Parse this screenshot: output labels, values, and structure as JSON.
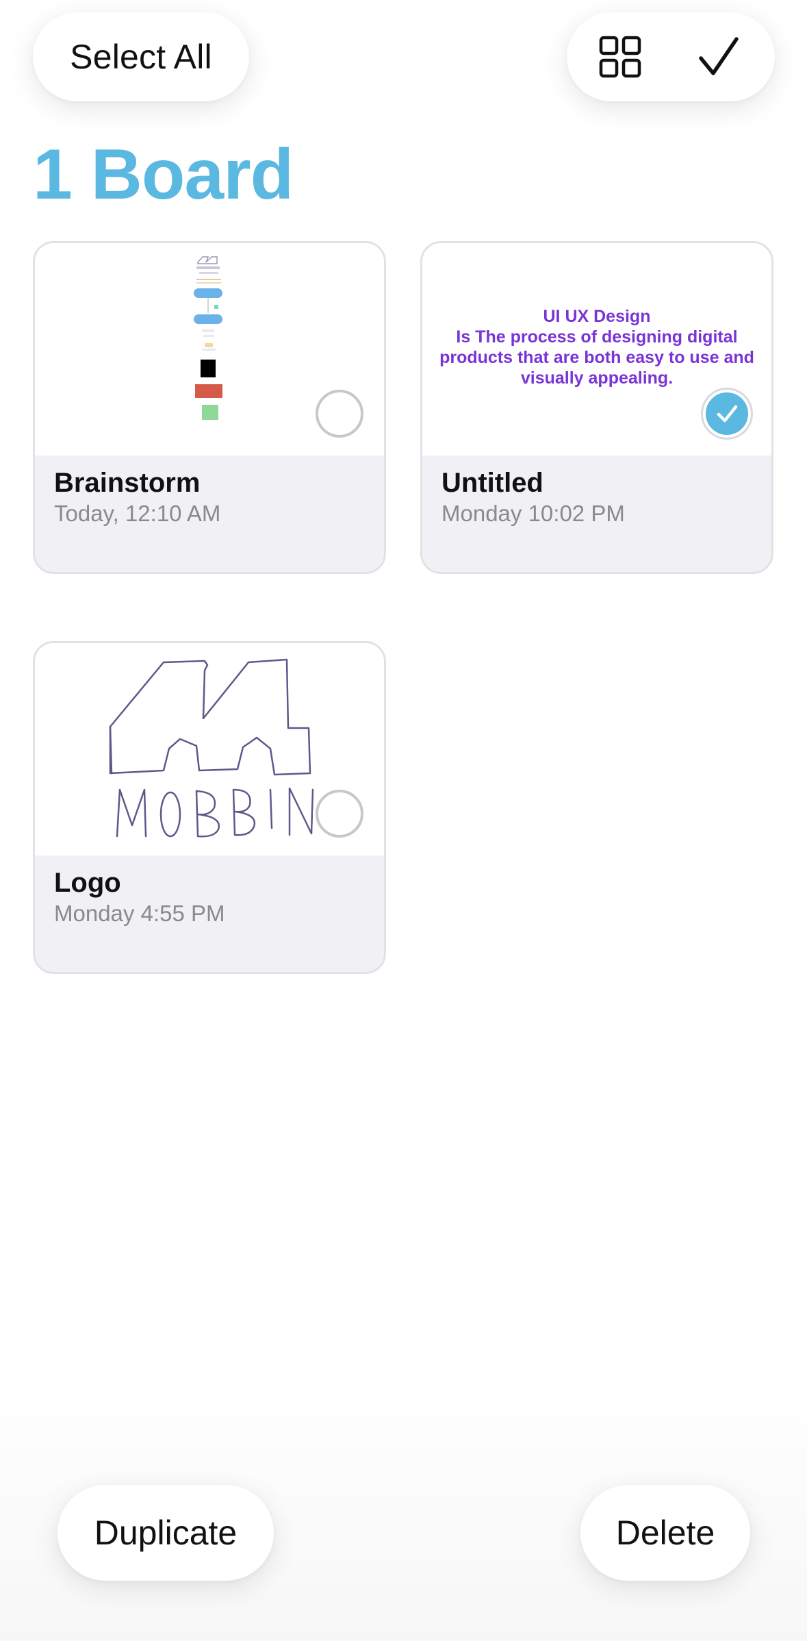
{
  "toolbar": {
    "select_all_label": "Select All",
    "grid_icon": "grid-icon",
    "done_icon": "checkmark-icon"
  },
  "heading": "1 Board",
  "boards": [
    {
      "title": "Brainstorm",
      "date": "Today, 12:10 AM",
      "selected": false,
      "thumbnail": "brainstorm-flowchart"
    },
    {
      "title": "Untitled",
      "date": "Monday 10:02 PM",
      "selected": true,
      "thumbnail": "text",
      "thumb_lines": [
        "UI UX Design",
        "Is The process of designing digital",
        "products that are both easy to use and",
        "visually appealing."
      ]
    },
    {
      "title": "Logo",
      "date": "Monday 4:55 PM",
      "selected": false,
      "thumbnail": "mobbin-sketch",
      "sketch_text": "MOBBIN"
    }
  ],
  "actions": {
    "duplicate_label": "Duplicate",
    "delete_label": "Delete"
  },
  "colors": {
    "accent": "#5bb8e0",
    "thumb_text": "#7a34d6",
    "sketch_ink": "#5b5a8a"
  }
}
